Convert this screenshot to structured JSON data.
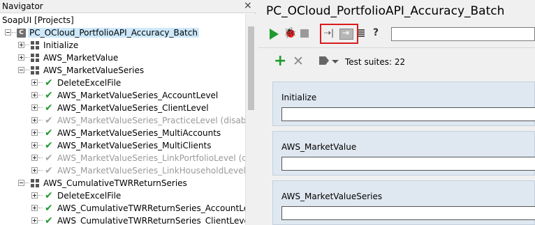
{
  "navigator": {
    "title": "Navigator",
    "close_glyph": "×",
    "workspace": "SoapUI [Projects]",
    "project": {
      "icon_letter": "C",
      "name": "PC_OCloud_PortfolioAPI_Accuracy_Batch"
    },
    "items": [
      {
        "label": "Initialize",
        "kind": "suite",
        "expander": "plus"
      },
      {
        "label": "AWS_MarketValue",
        "kind": "suite",
        "expander": "plus"
      },
      {
        "label": "AWS_MarketValueSeries",
        "kind": "suite",
        "expander": "minus"
      },
      {
        "label": "DeleteExcelFile",
        "kind": "case",
        "status": "check"
      },
      {
        "label": "AWS_MarketValueSeries_AccountLevel",
        "kind": "case",
        "status": "check"
      },
      {
        "label": "AWS_MarketValueSeries_ClientLevel",
        "kind": "case",
        "status": "check"
      },
      {
        "label": "AWS_MarketValueSeries_PracticeLevel (disabled)",
        "kind": "case",
        "status": "disabled"
      },
      {
        "label": "AWS_MarketValueSeries_MultiAccounts",
        "kind": "case",
        "status": "check"
      },
      {
        "label": "AWS_MarketValueSeries_MultiClients",
        "kind": "case",
        "status": "check"
      },
      {
        "label": "AWS_MarketValueSeries_LinkPortfolioLevel (disable",
        "kind": "case",
        "status": "disabled"
      },
      {
        "label": "AWS_MarketValueSeries_LinkHouseholdLevel (disal",
        "kind": "case",
        "status": "disabled"
      },
      {
        "label": "AWS_CumulativeTWRReturnSeries",
        "kind": "suite",
        "expander": "minus"
      },
      {
        "label": "DeleteExcelFile",
        "kind": "case",
        "status": "check"
      },
      {
        "label": "AWS_CumulativeTWRReturnSeries_AccountLevel",
        "kind": "case",
        "status": "check"
      },
      {
        "label": "AWS_CumulativeTWRReturnSeries_ClientLevel",
        "kind": "case",
        "status": "check"
      }
    ]
  },
  "main": {
    "title": "PC_OCloud_PortfolioAPI_Accuracy_Batch",
    "toolbar": {
      "run_icon": "play-icon",
      "debug_icon": "bug-icon",
      "stop_icon": "stop-icon",
      "step_glyph": "⇢|",
      "help_glyph": "?",
      "search_value": ""
    },
    "suites_toolbar": {
      "add_glyph": "+",
      "remove_glyph": "✕",
      "count_label": "Test suites: 22"
    },
    "suites": [
      {
        "name": "Initialize"
      },
      {
        "name": "AWS_MarketValue"
      },
      {
        "name": "AWS_MarketValueSeries"
      }
    ],
    "colors": {
      "accent_green": "#1e9b2e",
      "highlight_red": "#d91b1b",
      "suite_card_bg": "#dfe8f1",
      "selection_bg": "#cde8fb"
    }
  }
}
